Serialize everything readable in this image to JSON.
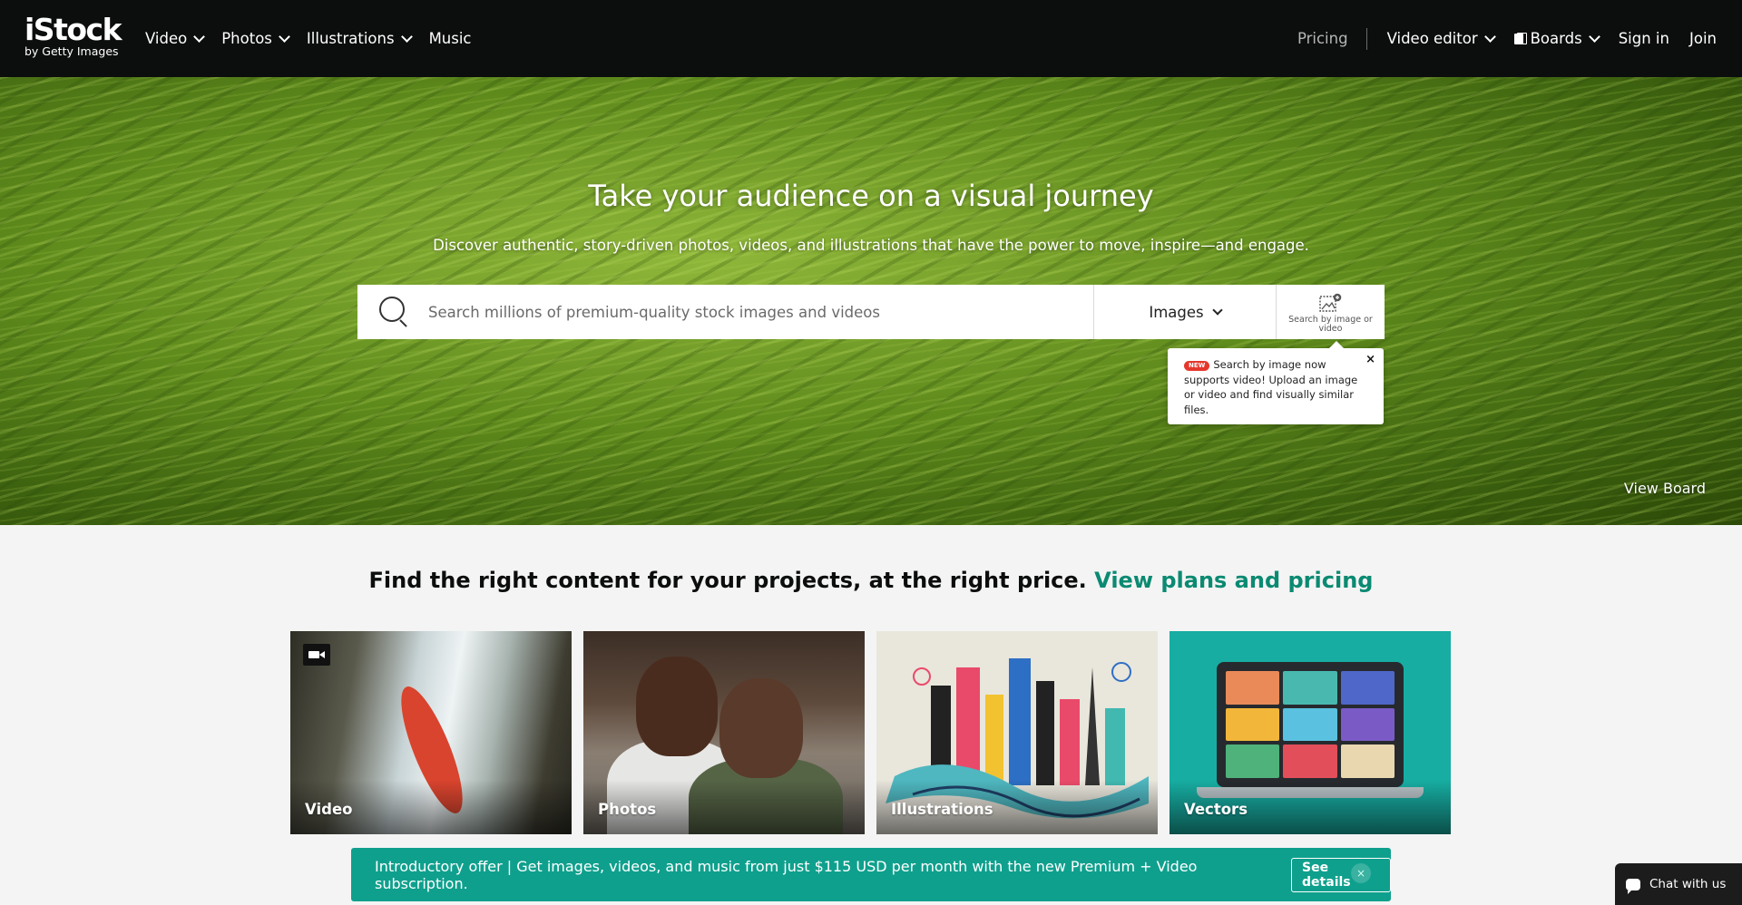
{
  "logo": {
    "brand": "iStock",
    "sub": "by Getty Images"
  },
  "nav": {
    "left": [
      "Video",
      "Photos",
      "Illustrations",
      "Music"
    ],
    "pricing": "Pricing",
    "video_editor": "Video editor",
    "boards": "Boards",
    "sign_in": "Sign in",
    "join": "Join"
  },
  "hero": {
    "title": "Take your audience on a visual journey",
    "subtitle": "Discover authentic, story-driven photos, videos, and illustrations that have the power to move, inspire—and engage.",
    "search_placeholder": "Search millions of premium-quality stock images and videos",
    "search_type": "Images",
    "search_by_image": "Search by image or video",
    "tooltip_badge": "NEW",
    "tooltip_text": "Search by image now supports video! Upload an image or video and find visually similar files.",
    "tooltip_close": "×",
    "view_board": "View Board"
  },
  "section": {
    "tagline": "Find the right content for your projects, at the right price.",
    "tagline_link": "View plans and pricing",
    "tiles": [
      "Video",
      "Photos",
      "Illustrations",
      "Vectors"
    ]
  },
  "promo": {
    "text": "Introductory offer | Get images, videos, and music from just $115 USD per month with the new Premium + Video subscription.",
    "button": "See details",
    "close": "×"
  },
  "chat": {
    "label": "Chat with us"
  },
  "icons": {
    "search": "search-icon",
    "camera": "video-camera-icon",
    "image_search": "image-search-icon",
    "boards": "boards-icon",
    "chat": "chat-bubble-icon"
  },
  "colors": {
    "nav_bg": "#0c0d0d",
    "accent": "#0b8a72",
    "promo_bg": "#0fa08d",
    "new_badge": "#e5372c"
  }
}
